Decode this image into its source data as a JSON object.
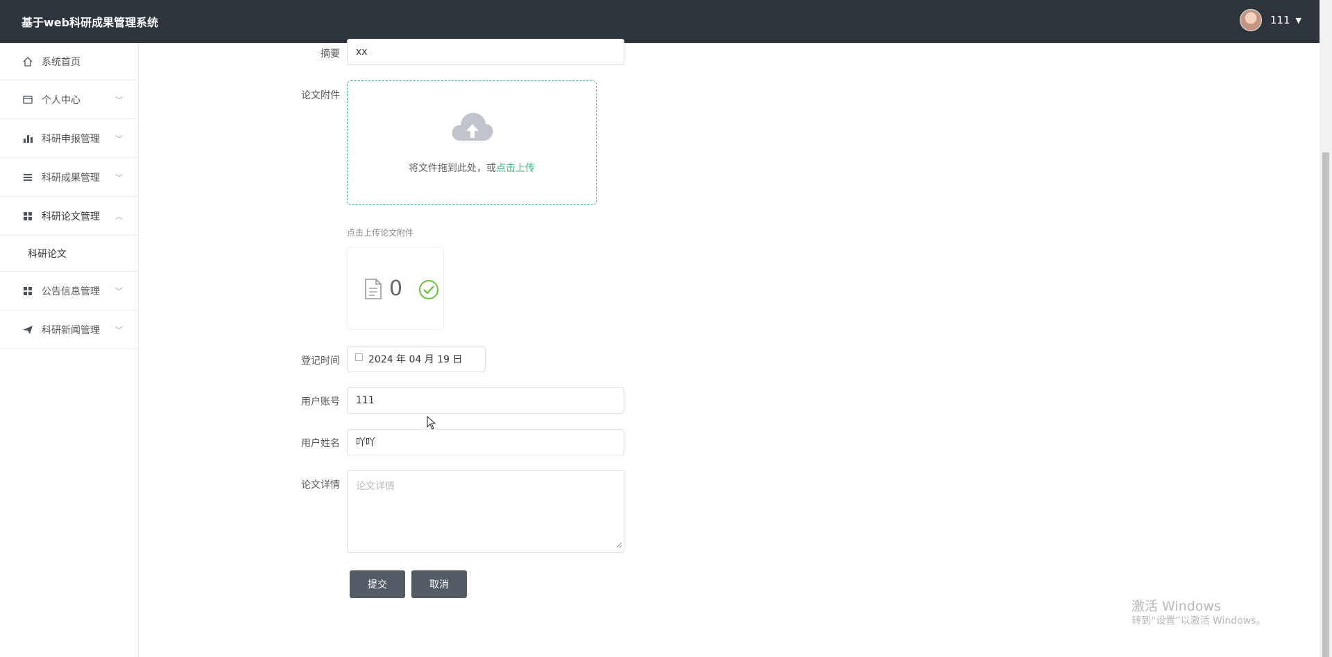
{
  "header": {
    "app_title": "基于web科研成果管理系统",
    "user_name": "111"
  },
  "sidebar": {
    "items": [
      {
        "label": "系统首页",
        "icon": "home-icon"
      },
      {
        "label": "个人中心",
        "icon": "wallet-icon"
      },
      {
        "label": "科研申报管理",
        "icon": "bar-chart-icon"
      },
      {
        "label": "科研成果管理",
        "icon": "list-icon"
      },
      {
        "label": "科研论文管理",
        "icon": "grid-icon",
        "expanded": true
      },
      {
        "label": "公告信息管理",
        "icon": "grid-icon"
      },
      {
        "label": "科研新闻管理",
        "icon": "send-icon"
      }
    ],
    "submenu": {
      "label": "科研论文"
    }
  },
  "form": {
    "abstract": {
      "label": "摘要",
      "value": "xx"
    },
    "attachment": {
      "label": "论文附件",
      "drop_text": "将文件拖到此处，或",
      "link_text": "点击上传",
      "tip": "点击上传论文附件",
      "file_count": "0"
    },
    "register_time": {
      "label": "登记时间",
      "value": "2024 年 04 月 19 日"
    },
    "user_account": {
      "label": "用户账号",
      "value": "111"
    },
    "user_name": {
      "label": "用户姓名",
      "value": "吖吖"
    },
    "details": {
      "label": "论文详情",
      "placeholder": "论文详情"
    },
    "submit_label": "提交",
    "cancel_label": "取消"
  },
  "watermark": {
    "line1": "激活 Windows",
    "line2": "转到“设置”以激活 Windows。"
  }
}
